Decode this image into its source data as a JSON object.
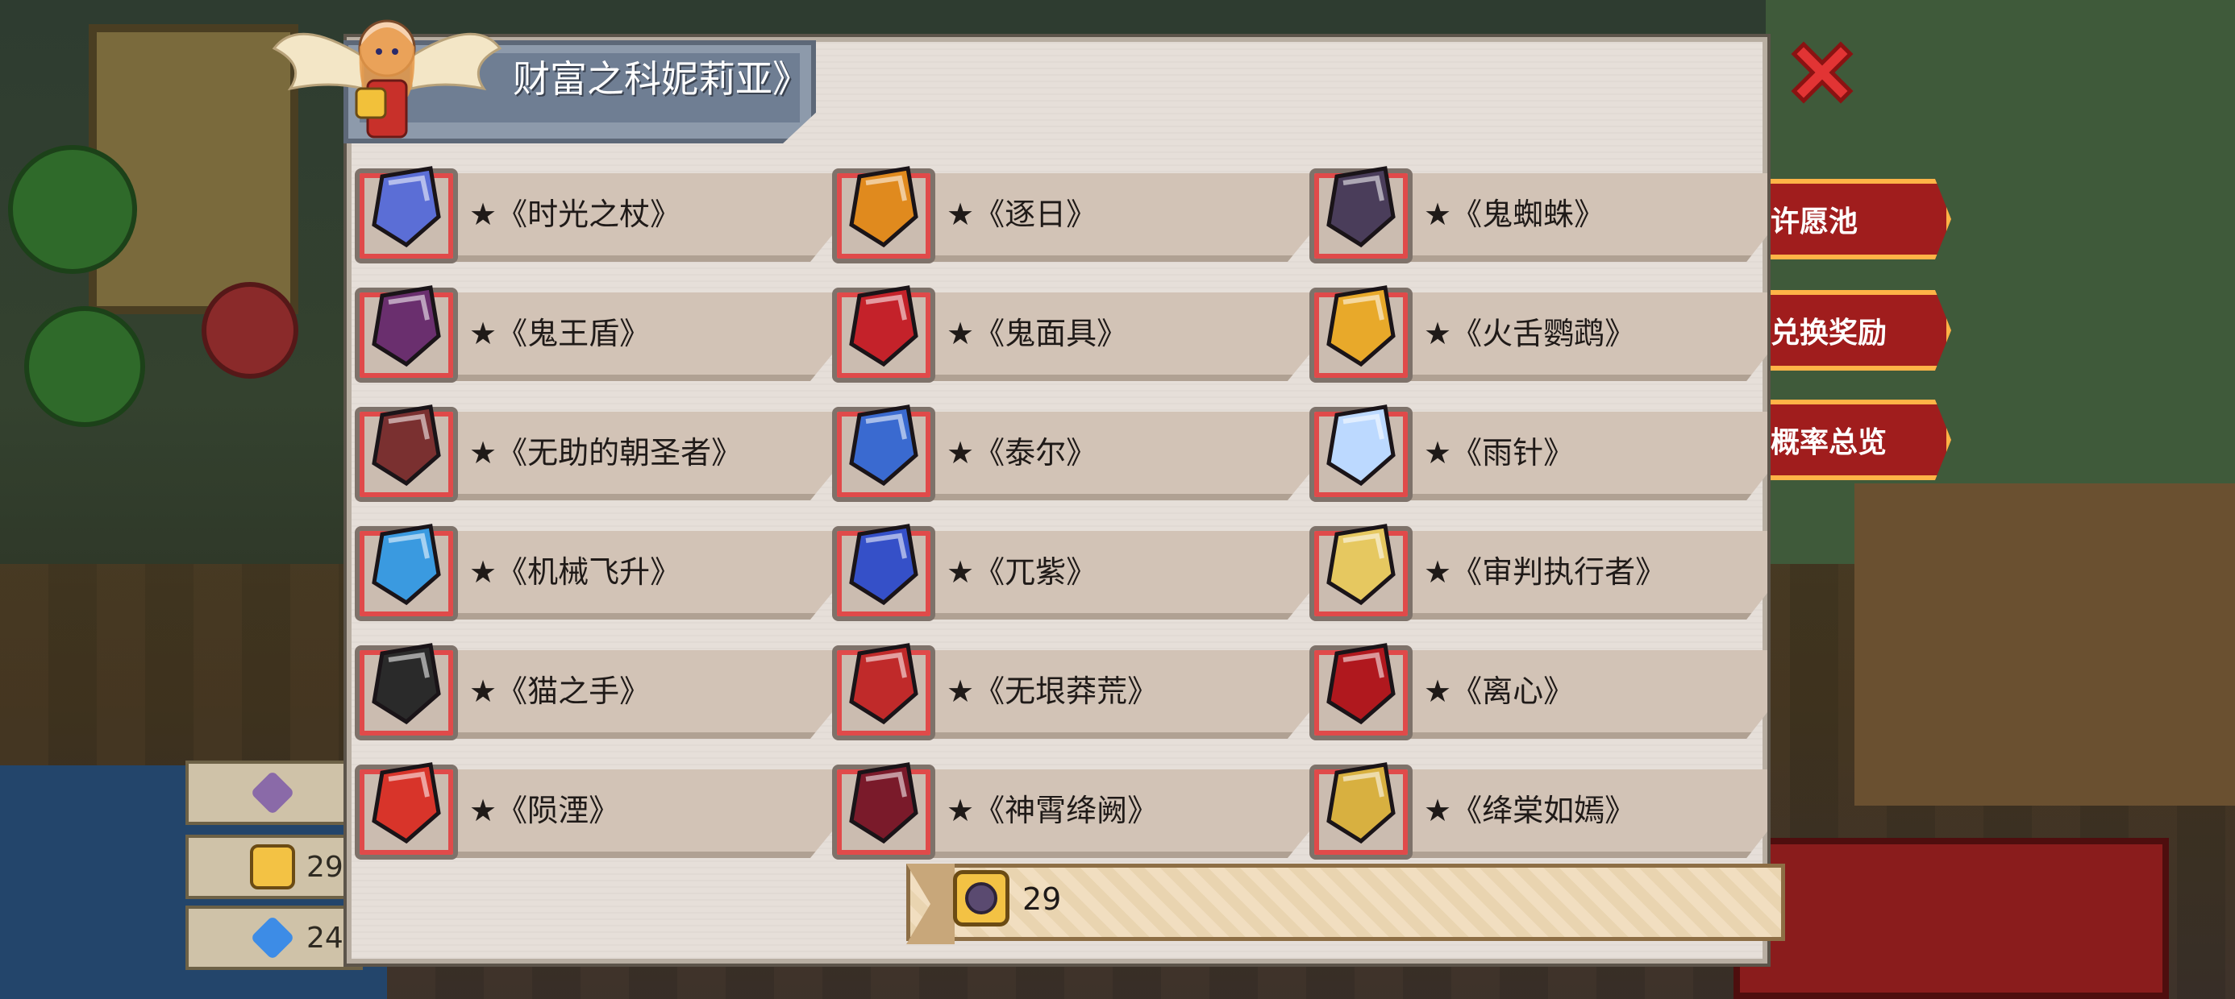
{
  "title": "财富之科妮莉亚》",
  "side_buttons": [
    "许愿池",
    "兑换奖励",
    "概率总览"
  ],
  "left_resources": [
    {
      "icon": "purple-gem-icon",
      "value": ""
    },
    {
      "icon": "gold-coin-icon",
      "value": "29"
    },
    {
      "icon": "blue-diamond-icon",
      "value": "24"
    }
  ],
  "items": [
    {
      "name": "★《时光之杖》",
      "icon": "staff-icon",
      "color": "#5b6ed6"
    },
    {
      "name": "★《逐日》",
      "icon": "sun-sword-icon",
      "color": "#e08a1e"
    },
    {
      "name": "★《鬼蜘蛛》",
      "icon": "spider-gun-icon",
      "color": "#4a3d5a"
    },
    {
      "name": "★《鬼王盾》",
      "icon": "shield-icon",
      "color": "#6a2f6e"
    },
    {
      "name": "★《鬼面具》",
      "icon": "mask-icon",
      "color": "#c4222a"
    },
    {
      "name": "★《火舌鹦鹉》",
      "icon": "parrot-gun-icon",
      "color": "#e8a92a"
    },
    {
      "name": "★《无助的朝圣者》",
      "icon": "armor-icon",
      "color": "#7a3030"
    },
    {
      "name": "★《泰尔》",
      "icon": "helmet-icon",
      "color": "#3a6ad0"
    },
    {
      "name": "★《雨针》",
      "icon": "needle-icon",
      "color": "#bcd9ff"
    },
    {
      "name": "★《机械飞升》",
      "icon": "wing-gun-icon",
      "color": "#3a9ae0"
    },
    {
      "name": "★《兀紫》",
      "icon": "gauntlet-icon",
      "color": "#3550c8"
    },
    {
      "name": "★《审判执行者》",
      "icon": "hooded-figure-icon",
      "color": "#e6c860"
    },
    {
      "name": "★《猫之手》",
      "icon": "cat-paw-icon",
      "color": "#2a2a2a"
    },
    {
      "name": "★《无垠莽荒》",
      "icon": "belt-icon",
      "color": "#c02a2a"
    },
    {
      "name": "★《离心》",
      "icon": "dagger-icon",
      "color": "#b0181e"
    },
    {
      "name": "★《陨湮》",
      "icon": "flame-blade-icon",
      "color": "#d8342a"
    },
    {
      "name": "★《神霄绛阙》",
      "icon": "amulet-icon",
      "color": "#7a1a2a"
    },
    {
      "name": "★《绛棠如嫣》",
      "icon": "ring-icon",
      "color": "#d8b040"
    }
  ],
  "currency": {
    "icon": "gold-coin-icon",
    "value": "29"
  }
}
